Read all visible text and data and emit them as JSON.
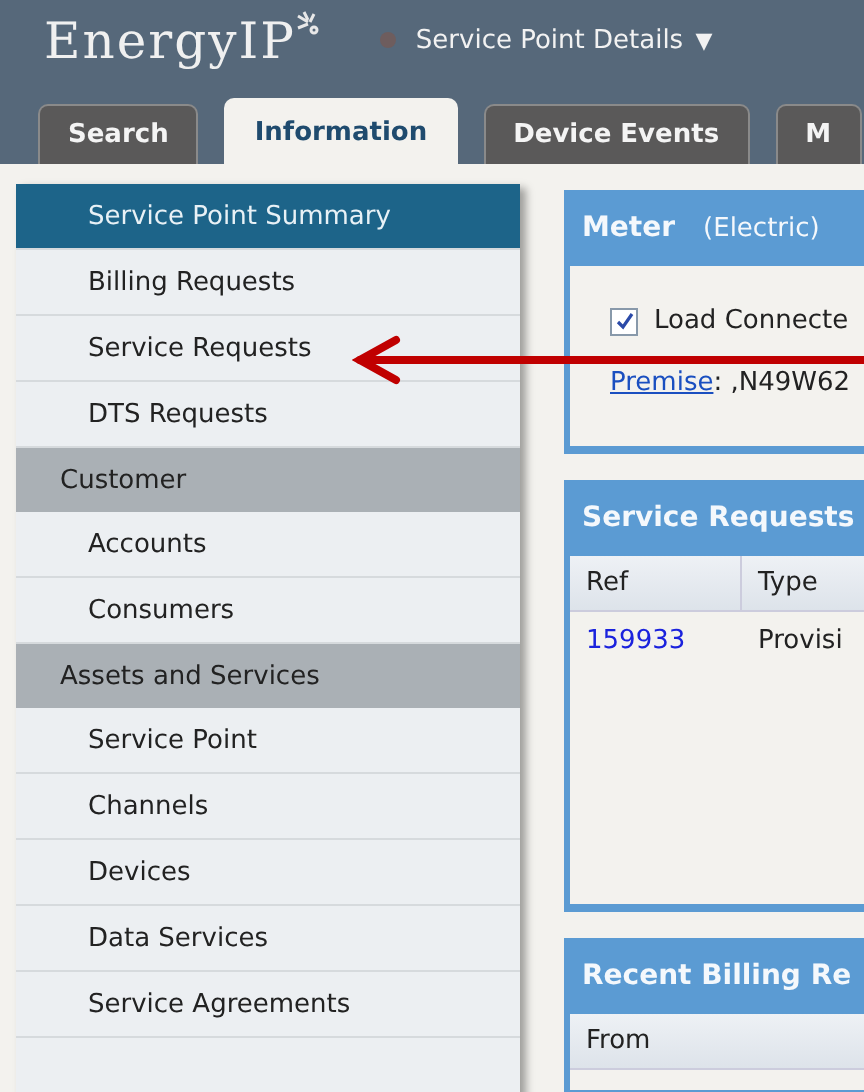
{
  "header": {
    "logo": "EnergyIP",
    "page_menu": "Service Point Details",
    "menu_caret": "▼"
  },
  "tabs": [
    {
      "label": "Search",
      "selected": false
    },
    {
      "label": "Information",
      "selected": true
    },
    {
      "label": "Device Events",
      "selected": false
    },
    {
      "label": "M",
      "selected": false
    }
  ],
  "sidebar": {
    "sections": [
      {
        "items": [
          {
            "label": "Service Point Summary",
            "selected": true
          },
          {
            "label": "Billing Requests",
            "selected": false
          },
          {
            "label": "Service Requests",
            "selected": false
          },
          {
            "label": "DTS Requests",
            "selected": false
          }
        ]
      },
      {
        "heading": "Customer",
        "items": [
          {
            "label": "Accounts",
            "selected": false
          },
          {
            "label": "Consumers",
            "selected": false
          }
        ]
      },
      {
        "heading": "Assets and Services",
        "items": [
          {
            "label": "Service Point",
            "selected": false
          },
          {
            "label": "Channels",
            "selected": false
          },
          {
            "label": "Devices",
            "selected": false
          },
          {
            "label": "Data Services",
            "selected": false
          },
          {
            "label": "Service Agreements",
            "selected": false
          }
        ]
      }
    ]
  },
  "meter_panel": {
    "title": "Meter",
    "subtitle": "(Electric)",
    "load_connected": {
      "label": "Load Connecte",
      "checked": true
    },
    "premise_link": "Premise",
    "premise_value": ": ,N49W62"
  },
  "service_requests_panel": {
    "title": "Service Requests",
    "columns": [
      "Ref",
      "Type"
    ],
    "rows": [
      [
        "159933",
        "Provisi"
      ]
    ]
  },
  "billing_panel": {
    "title": "Recent Billing Re",
    "columns": [
      "From"
    ]
  }
}
